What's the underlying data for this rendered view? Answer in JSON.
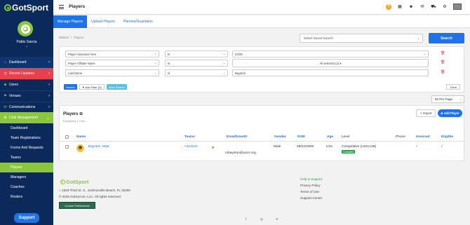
{
  "app": {
    "logo_text": "GotSport"
  },
  "user": {
    "name": "Pablo Garcia",
    "caret": "⌄"
  },
  "sidebar": {
    "items": [
      {
        "label": "Dashboard",
        "icon": "⌂"
      },
      {
        "label": "Recent Updates",
        "icon": "◷"
      },
      {
        "label": "Users",
        "icon": "☻"
      },
      {
        "label": "Venues",
        "icon": "⚑"
      },
      {
        "label": "Communications",
        "icon": "✉"
      },
      {
        "label": "Club Management",
        "icon": "⚙"
      }
    ],
    "sub_items": [
      "Dashboard",
      "Team Registrations",
      "Forms And Requests",
      "Teams",
      "Players",
      "Managers",
      "Coaches",
      "Rosters"
    ],
    "support_label": "Support"
  },
  "topbar": {
    "title": "Players"
  },
  "tabs": [
    "Manage Players",
    "Upload Players",
    "Parents/Guardians"
  ],
  "breadcrumb": [
    "958410",
    "/",
    "Players"
  ],
  "saved_search": {
    "placeholder": "Select Saved Search",
    "button": "Search"
  },
  "filters": {
    "rows": [
      {
        "field": "Player Seasonal Year",
        "op": "Is",
        "value": "24/25"
      },
      {
        "field": "Player Affiliate Name",
        "op": "Is",
        "value": "All selected (2) ▾"
      },
      {
        "field": "Last Name",
        "op": "Is",
        "value": "Bayston"
      }
    ],
    "search_label": "Search",
    "add_filter_label": "▼ Add Filter (3)",
    "save_search_label": "Save Search",
    "clear_label": "Clear"
  },
  "per_page": "50 Per Page",
  "players_panel": {
    "title": "Players ⊖",
    "subtitle": "Displaying 1 User",
    "export_label": "⇪ Export",
    "add_label": "⊕ Add Player",
    "columns": [
      "Name",
      "Teams",
      "Email/UserID",
      "Gender",
      "DOB",
      "Age",
      "Level",
      "Phone",
      "Invoiced",
      "Eligible"
    ],
    "rows": [
      {
        "name": "Bayston, Matt",
        "team": "Kickers",
        "email": "mbayston@uscs.org",
        "gender": "Male",
        "dob": "08/22/2009",
        "age": "U16",
        "level": "Competitive (USCLUB)",
        "badge": "Complete",
        "phone": "",
        "invoiced": "✓",
        "eligible": "✓"
      }
    ]
  },
  "footer": {
    "logo_text": "GotSport",
    "address": "⌂ 1529 Third St. S., Jacksonville Beach, FL 32250",
    "copyright": "© 2025 GotSoccer, LLC. All rights reserved.",
    "cookie_label": "Cookie Preferences",
    "links": [
      "Help & Support",
      "Privacy Policy",
      "Terms of Use",
      "Support Center"
    ],
    "social": [
      "f",
      "◎",
      "✈"
    ]
  }
}
